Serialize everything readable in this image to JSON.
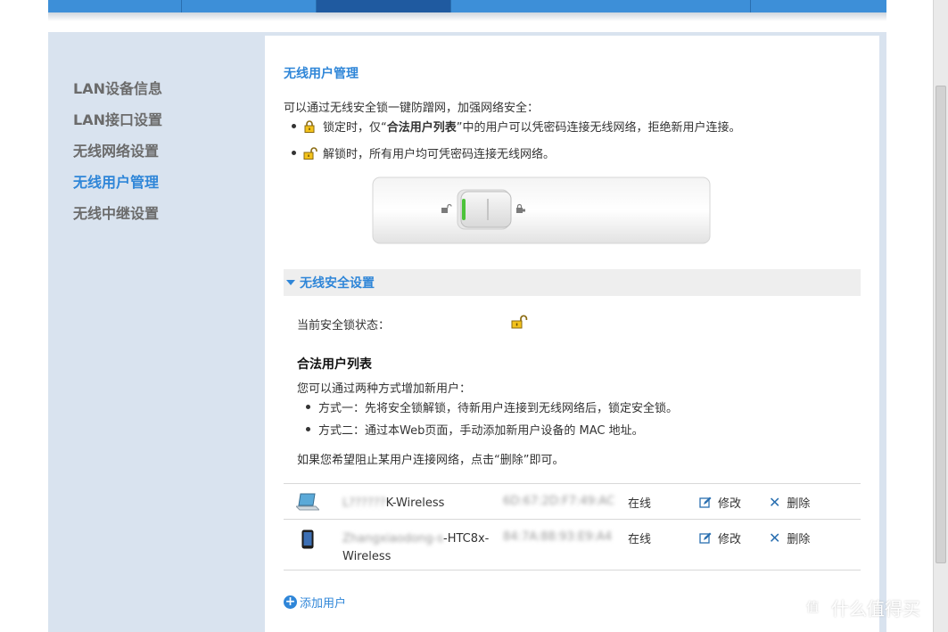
{
  "sidebar": {
    "items": [
      {
        "label": "LAN设备信息",
        "active": false
      },
      {
        "label": "LAN接口设置",
        "active": false
      },
      {
        "label": "无线网络设置",
        "active": false
      },
      {
        "label": "无线用户管理",
        "active": true
      },
      {
        "label": "无线中继设置",
        "active": false
      }
    ]
  },
  "main": {
    "title": "无线用户管理",
    "intro": "可以通过无线安全锁一键防蹭网，加强网络安全：",
    "bullets": {
      "locked_prefix": "锁定时，仅“",
      "locked_bold": "合法用户列表",
      "locked_suffix": "”中的用户可以凭密码连接无线网络，拒绝新用户连接。",
      "unlocked": "解锁时，所有用户均可凭密码连接无线网络。"
    },
    "section": {
      "title": "无线安全设置",
      "lock_status_label": "当前安全锁状态：",
      "lock_status_icon": "unlocked-icon"
    },
    "legal_list": {
      "title": "合法用户列表",
      "desc": "您可以通过两种方式增加新用户：",
      "method1": "方式一：先将安全锁解锁，待新用户连接到无线网络后，锁定安全锁。",
      "method2": "方式二：通过本Web页面，手动添加新用户设备的 MAC 地址。",
      "block_note": "如果您希望阻止某用户连接网络，点击“删除”即可。"
    },
    "devices": [
      {
        "type": "laptop-icon",
        "name_hidden": "L??????",
        "name_visible": "K-Wireless",
        "mac": "6D:67:2D:F7:49:AC",
        "status": "在线",
        "edit": "修改",
        "delete": "删除"
      },
      {
        "type": "phone-icon",
        "name_hidden": "Zhangxiaodong-s",
        "name_visible": "-HTC8x-",
        "name_line2": "Wireless",
        "mac": "84:7A:88:93:E9:A4",
        "status": "在线",
        "edit": "修改",
        "delete": "删除"
      }
    ],
    "add_user": "添加用户"
  },
  "watermark": "什么值得买",
  "colors": {
    "accent": "#2f86d8",
    "nav": "#3d8fd8",
    "sidebar_bg": "#d9e3ef"
  }
}
